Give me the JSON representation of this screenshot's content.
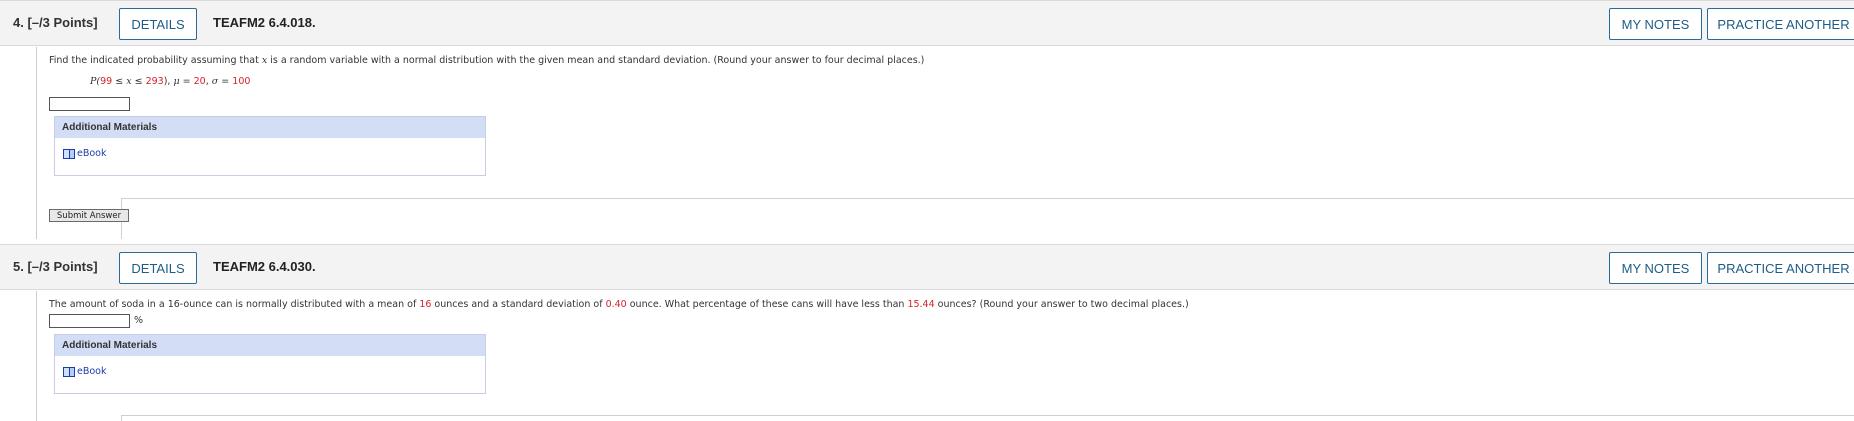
{
  "questions": [
    {
      "number": "4.",
      "points": "[–/3 Points]",
      "details_label": "DETAILS",
      "code": "TEAFM2 6.4.018.",
      "my_notes_label": "MY NOTES",
      "practice_label": "PRACTICE ANOTHER",
      "prompt": {
        "pre": "Find the indicated probability assuming that ",
        "var": "x",
        "post": " is a random variable with a normal distribution with the given mean and standard deviation. (Round your answer to four decimal places.)"
      },
      "expression": {
        "p_open": "P(",
        "lower": "99",
        "le1": " ≤ ",
        "var": "x",
        "le2": " ≤ ",
        "upper": "293",
        "p_close": "), ",
        "mu": "μ",
        "eq1": " = ",
        "mean": "20",
        "sep": ", ",
        "sigma": "σ",
        "eq2": " = ",
        "sd": "100"
      },
      "answer_value": "",
      "materials_label": "Additional Materials",
      "ebook_label": "eBook",
      "submit_label": "Submit Answer"
    },
    {
      "number": "5.",
      "points": "[–/3 Points]",
      "details_label": "DETAILS",
      "code": "TEAFM2 6.4.030.",
      "my_notes_label": "MY NOTES",
      "practice_label": "PRACTICE ANOTHER",
      "prompt": {
        "t1": "The amount of soda in a 16-ounce can is normally distributed with a mean of ",
        "mean": "16",
        "t2": " ounces and a standard deviation of ",
        "sd": "0.40",
        "t3": " ounce. What percentage of these cans will have less than ",
        "threshold": "15.44",
        "t4": " ounces? (Round your answer to two decimal places.)"
      },
      "answer_value": "",
      "unit": "%",
      "materials_label": "Additional Materials",
      "ebook_label": "eBook"
    }
  ],
  "colors": {
    "accent": "#1d5c87",
    "highlight": "#d8202a",
    "materials_header": "#d3ddf6",
    "link": "#1a3ea8"
  },
  "icons": [
    "book-icon"
  ]
}
